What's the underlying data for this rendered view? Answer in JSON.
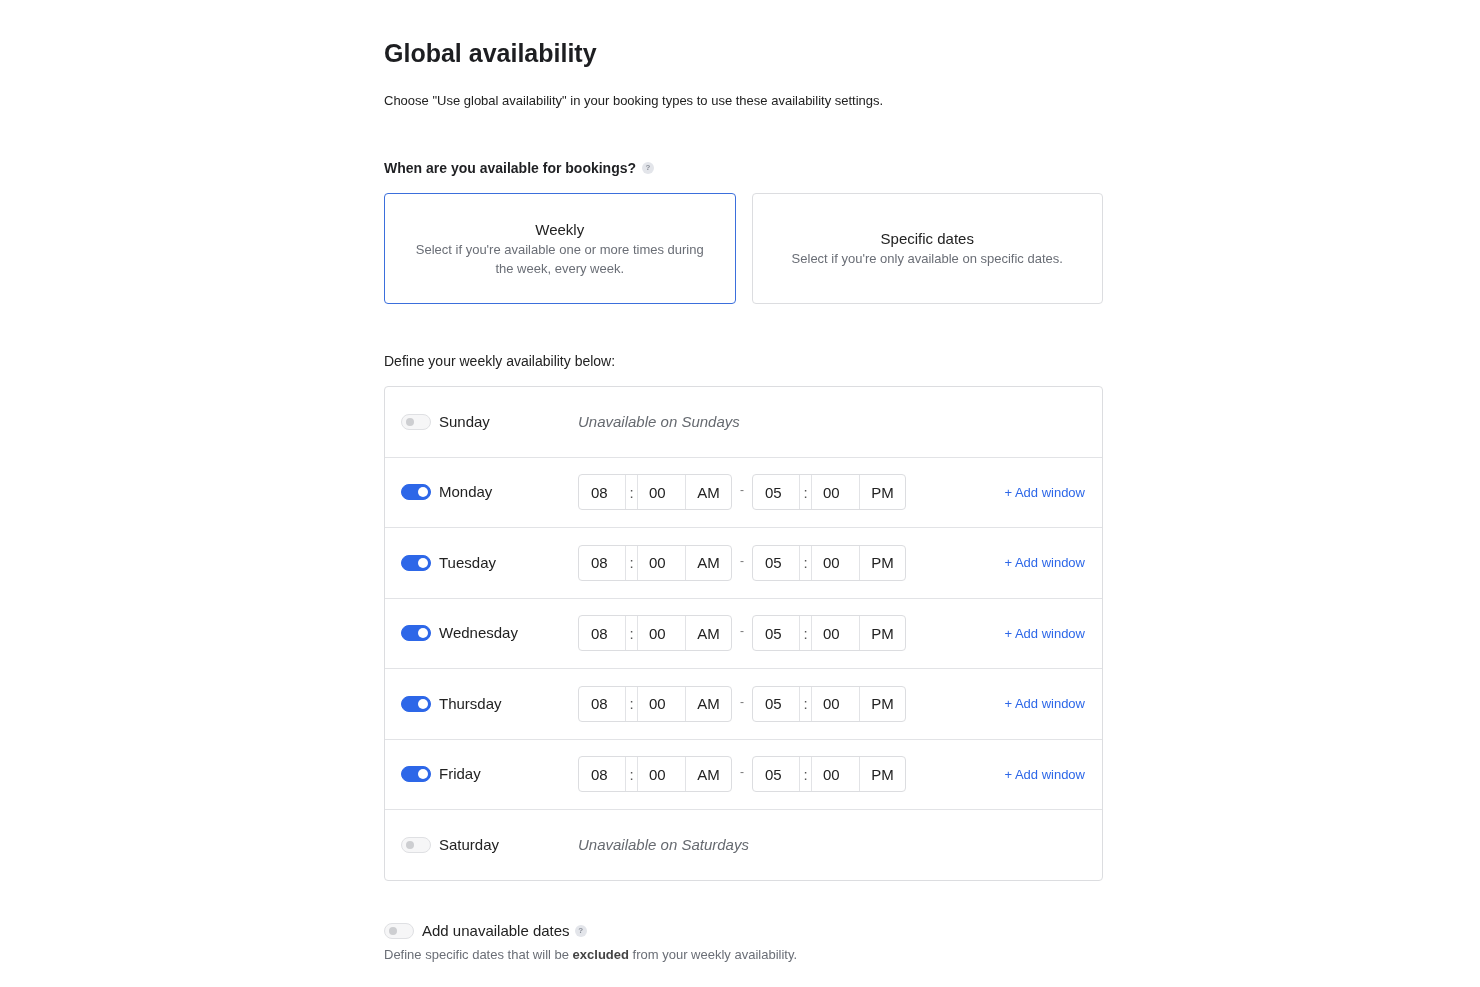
{
  "page": {
    "title": "Global availability",
    "subtitle": "Choose \"Use global availability\" in your booking types to use these availability settings."
  },
  "question": {
    "label": "When are you available for bookings?",
    "help": "?"
  },
  "options": [
    {
      "title": "Weekly",
      "description": "Select if you're available one or more times during the week, every week.",
      "selected": true
    },
    {
      "title": "Specific dates",
      "description": "Select if you're only available on specific dates.",
      "selected": false
    }
  ],
  "weekly_heading": "Define your weekly availability below:",
  "days": [
    {
      "day": "Sunday",
      "on": false,
      "note": "Unavailable on Sundays"
    },
    {
      "day": "Monday",
      "on": true,
      "start": {
        "hour": "08",
        "separator": ":",
        "minute": "00",
        "period": "AM"
      },
      "dash": "-",
      "end": {
        "hour": "05",
        "separator": ":",
        "minute": "00",
        "period": "PM"
      },
      "add_window": "+ Add window"
    },
    {
      "day": "Tuesday",
      "on": true,
      "start": {
        "hour": "08",
        "separator": ":",
        "minute": "00",
        "period": "AM"
      },
      "dash": "-",
      "end": {
        "hour": "05",
        "separator": ":",
        "minute": "00",
        "period": "PM"
      },
      "add_window": "+ Add window"
    },
    {
      "day": "Wednesday",
      "on": true,
      "start": {
        "hour": "08",
        "separator": ":",
        "minute": "00",
        "period": "AM"
      },
      "dash": "-",
      "end": {
        "hour": "05",
        "separator": ":",
        "minute": "00",
        "period": "PM"
      },
      "add_window": "+ Add window"
    },
    {
      "day": "Thursday",
      "on": true,
      "start": {
        "hour": "08",
        "separator": ":",
        "minute": "00",
        "period": "AM"
      },
      "dash": "-",
      "end": {
        "hour": "05",
        "separator": ":",
        "minute": "00",
        "period": "PM"
      },
      "add_window": "+ Add window"
    },
    {
      "day": "Friday",
      "on": true,
      "start": {
        "hour": "08",
        "separator": ":",
        "minute": "00",
        "period": "AM"
      },
      "dash": "-",
      "end": {
        "hour": "05",
        "separator": ":",
        "minute": "00",
        "period": "PM"
      },
      "add_window": "+ Add window"
    },
    {
      "day": "Saturday",
      "on": false,
      "note": "Unavailable on Saturdays"
    }
  ],
  "unavailable_dates": {
    "on": false,
    "label": "Add unavailable dates",
    "help": "?",
    "description": "Define specific dates that will be **excluded** from your weekly availability."
  }
}
